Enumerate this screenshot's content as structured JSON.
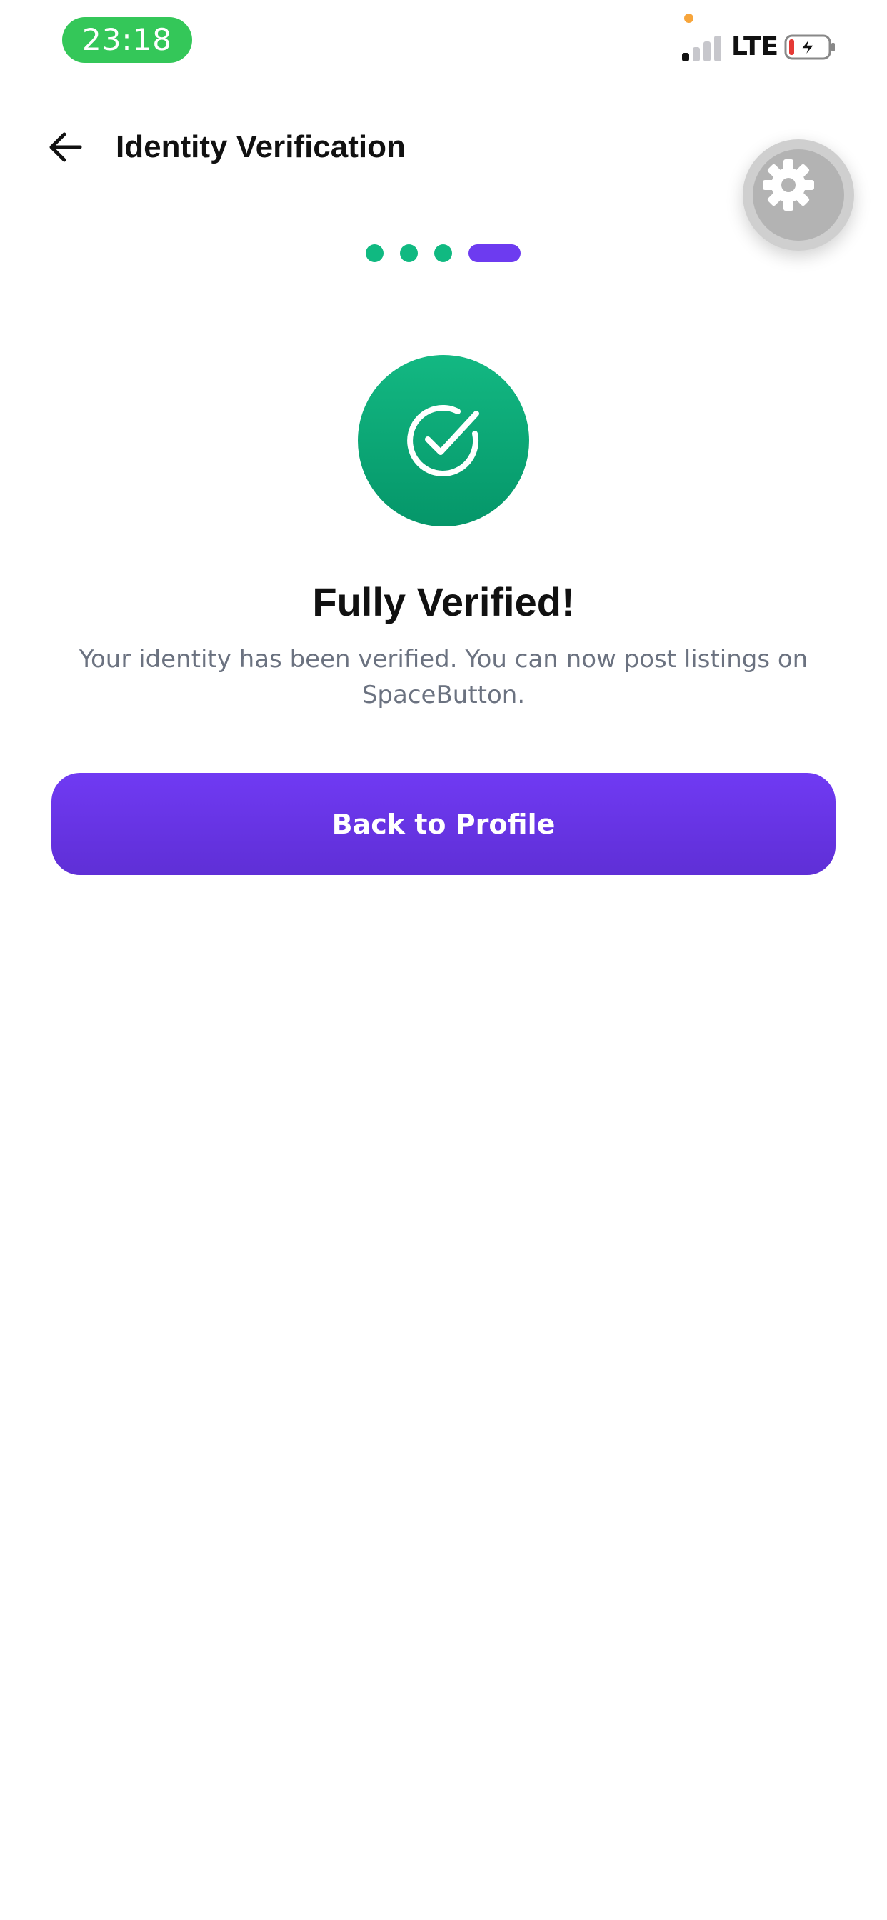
{
  "status_bar": {
    "time": "23:18",
    "network": "LTE",
    "battery_state": "low-charging",
    "signal_bars_active": 1,
    "signal_bars_total": 4
  },
  "header": {
    "title": "Identity Verification",
    "back_icon": "arrow-left-icon",
    "settings_icon": "gear-icon"
  },
  "progress": {
    "total_steps": 4,
    "current_step": 4,
    "completed_color": "#10b981",
    "active_color": "#6d3bf0"
  },
  "result": {
    "icon": "check-circle-icon",
    "title": "Fully Verified!",
    "message": "Your identity has been verified. You can now post listings on SpaceButton."
  },
  "actions": {
    "primary_label": "Back to Profile"
  },
  "colors": {
    "brand_purple": "#6d3bf0",
    "success_green": "#10b981",
    "status_pill": "#34c759"
  }
}
